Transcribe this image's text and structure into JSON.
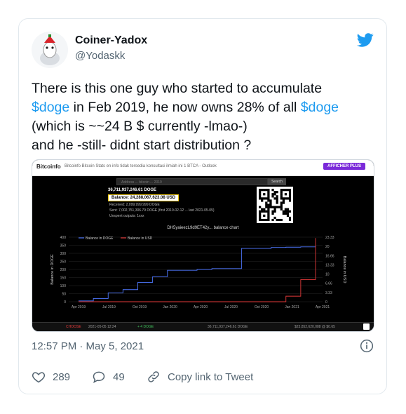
{
  "tweet": {
    "author_name": "Coiner-Yadox",
    "handle": "@Yodaskk",
    "text_lines": [
      [
        {
          "t": "There is this one guy who started to accumulate",
          "cash": false
        }
      ],
      [
        {
          "t": "$doge",
          "cash": true
        },
        {
          "t": " in Feb 2019, he now owns 28% of all ",
          "cash": false
        },
        {
          "t": "$doge",
          "cash": true
        }
      ],
      [
        {
          "t": "(which is ~~24 B $ currently -lmao-)",
          "cash": false
        }
      ],
      [
        {
          "t": "and he -still- didnt start distribution ?",
          "cash": false
        }
      ]
    ],
    "timestamp": "12:57 PM · May 5, 2021",
    "likes": "289",
    "replies": "49",
    "copy_link_label": "Copy link to Tweet"
  },
  "media": {
    "site_logo": "Bitcoinfo",
    "site_desc": "Bitcoinfo Bitcoin Stats en info tidak tersedia konsultasi ilmiah ini 1 BTCA - Outlook",
    "cta_label": "AFFICHER PLUS",
    "search_placeholder": "Address ... bitcoin ... 2019",
    "search_button": "Search",
    "amount": "36,711,937,246.61 DOGE",
    "balance_label": "Balance: 24,288,067,623.08 USD",
    "rows": [
      "Received: 2,099,999,999 DOGE",
      "Sent: 7,002,751,306.79 DOGE (first 2019-02-12 ... last 2021-05-05)",
      "Unspent outputs: 1xxx"
    ],
    "chart_title": "DH5yaieezL9d9ET42y... balance chart",
    "footer": [
      "CHOOSE",
      "2021-05-05 12:24",
      "+ 4 DOGE",
      "36,711,937,246.61 DOGE",
      "$23,852,620,088 @ $0.65"
    ]
  },
  "chart_data": {
    "type": "line",
    "title": "DH5yaieezL9d9ET42y... balance chart",
    "legend": [
      "Balance in DOGE",
      "Balance in USD"
    ],
    "x": [
      "Apr 2019",
      "Jul 2019",
      "Oct 2019",
      "Jan 2020",
      "Apr 2020",
      "Jul 2020",
      "Oct 2020",
      "Jan 2021",
      "Apr 2021"
    ],
    "ylabel_left": "Balance in DOGE",
    "ylabel_right": "Balance in USD",
    "yticks_left": [
      "0",
      "50",
      "100",
      "150",
      "200",
      "250",
      "300",
      "350",
      "400"
    ],
    "yticks_right": [
      "0",
      "3.33",
      "6.66",
      "10",
      "13.33",
      "16.66",
      "20",
      "23.33"
    ],
    "series": [
      {
        "name": "Balance in DOGE",
        "color": "#4f78ff",
        "values": [
          5,
          20,
          55,
          75,
          120,
          155,
          195,
          195,
          200,
          205,
          205,
          330,
          330,
          336,
          338,
          340,
          345
        ]
      },
      {
        "name": "Balance in USD",
        "color": "#e33a3a",
        "values": [
          0,
          0,
          0,
          0,
          0,
          0,
          0,
          0,
          0,
          0,
          0,
          0,
          0,
          0,
          2,
          8,
          23
        ]
      }
    ]
  }
}
